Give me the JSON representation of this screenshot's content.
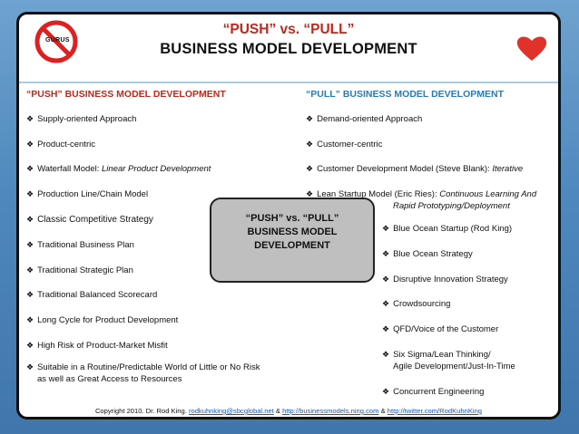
{
  "title": {
    "line1": "“PUSH” vs. “PULL”",
    "line2": "BUSINESS MODEL DEVELOPMENT"
  },
  "gurus_label": "GURUS",
  "left": {
    "heading": "“PUSH” BUSINESS MODEL DEVELOPMENT",
    "items": [
      "Supply-oriented Approach",
      "Product-centric",
      "Waterfall Model: ",
      "Production Line/Chain Model",
      "Classic Competitive Strategy",
      "Traditional Business Plan",
      "Traditional Strategic Plan",
      "Traditional Balanced Scorecard",
      "Long Cycle for Product Development",
      "High Risk of Product-Market Misfit",
      "Suitable in a Routine/Predictable World of Little or No Risk",
      "as well as Great Access to Resources"
    ],
    "waterfall_italic": "Linear Product Development"
  },
  "right": {
    "heading": "“PULL” BUSINESS MODEL DEVELOPMENT",
    "items": [
      "Demand-oriented Approach",
      "Customer-centric",
      "Customer Development Model (Steve Blank): ",
      "Lean Startup Model (Eric Ries): ",
      "Blue Ocean Startup (Rod King)",
      "Blue Ocean Strategy",
      "Disruptive Innovation Strategy",
      "Crowdsourcing",
      "QFD/Voice of the Customer",
      "Six Sigma/Lean Thinking/",
      "Agile Development/Just-In-Time",
      "Concurrent Engineering"
    ],
    "customer_dev_italic": "Iterative",
    "lean_italic_1": "Continuous Learning And",
    "lean_italic_2": "Rapid Prototyping/Deployment"
  },
  "center_box": {
    "line1": "“PUSH” vs. “PULL”",
    "line2": "BUSINESS MODEL",
    "line3": "DEVELOPMENT"
  },
  "footer": {
    "prefix": "Copyright 2010. Dr. Rod King. ",
    "email": "rodkuhnking@sbcglobal.net",
    "sep1": " & ",
    "link1": "http://businessmodels.ning.com",
    "sep2": " & ",
    "link2": "http://twitter.com/RodKuhnKing"
  },
  "colors": {
    "push_red": "#c0281d",
    "pull_blue": "#2b79bd",
    "background_blue": "#4f88bd",
    "heart_red": "#e0312b"
  },
  "icons": [
    "no-gurus-sign-icon",
    "heart-icon",
    "diamond-bullet-icon"
  ]
}
